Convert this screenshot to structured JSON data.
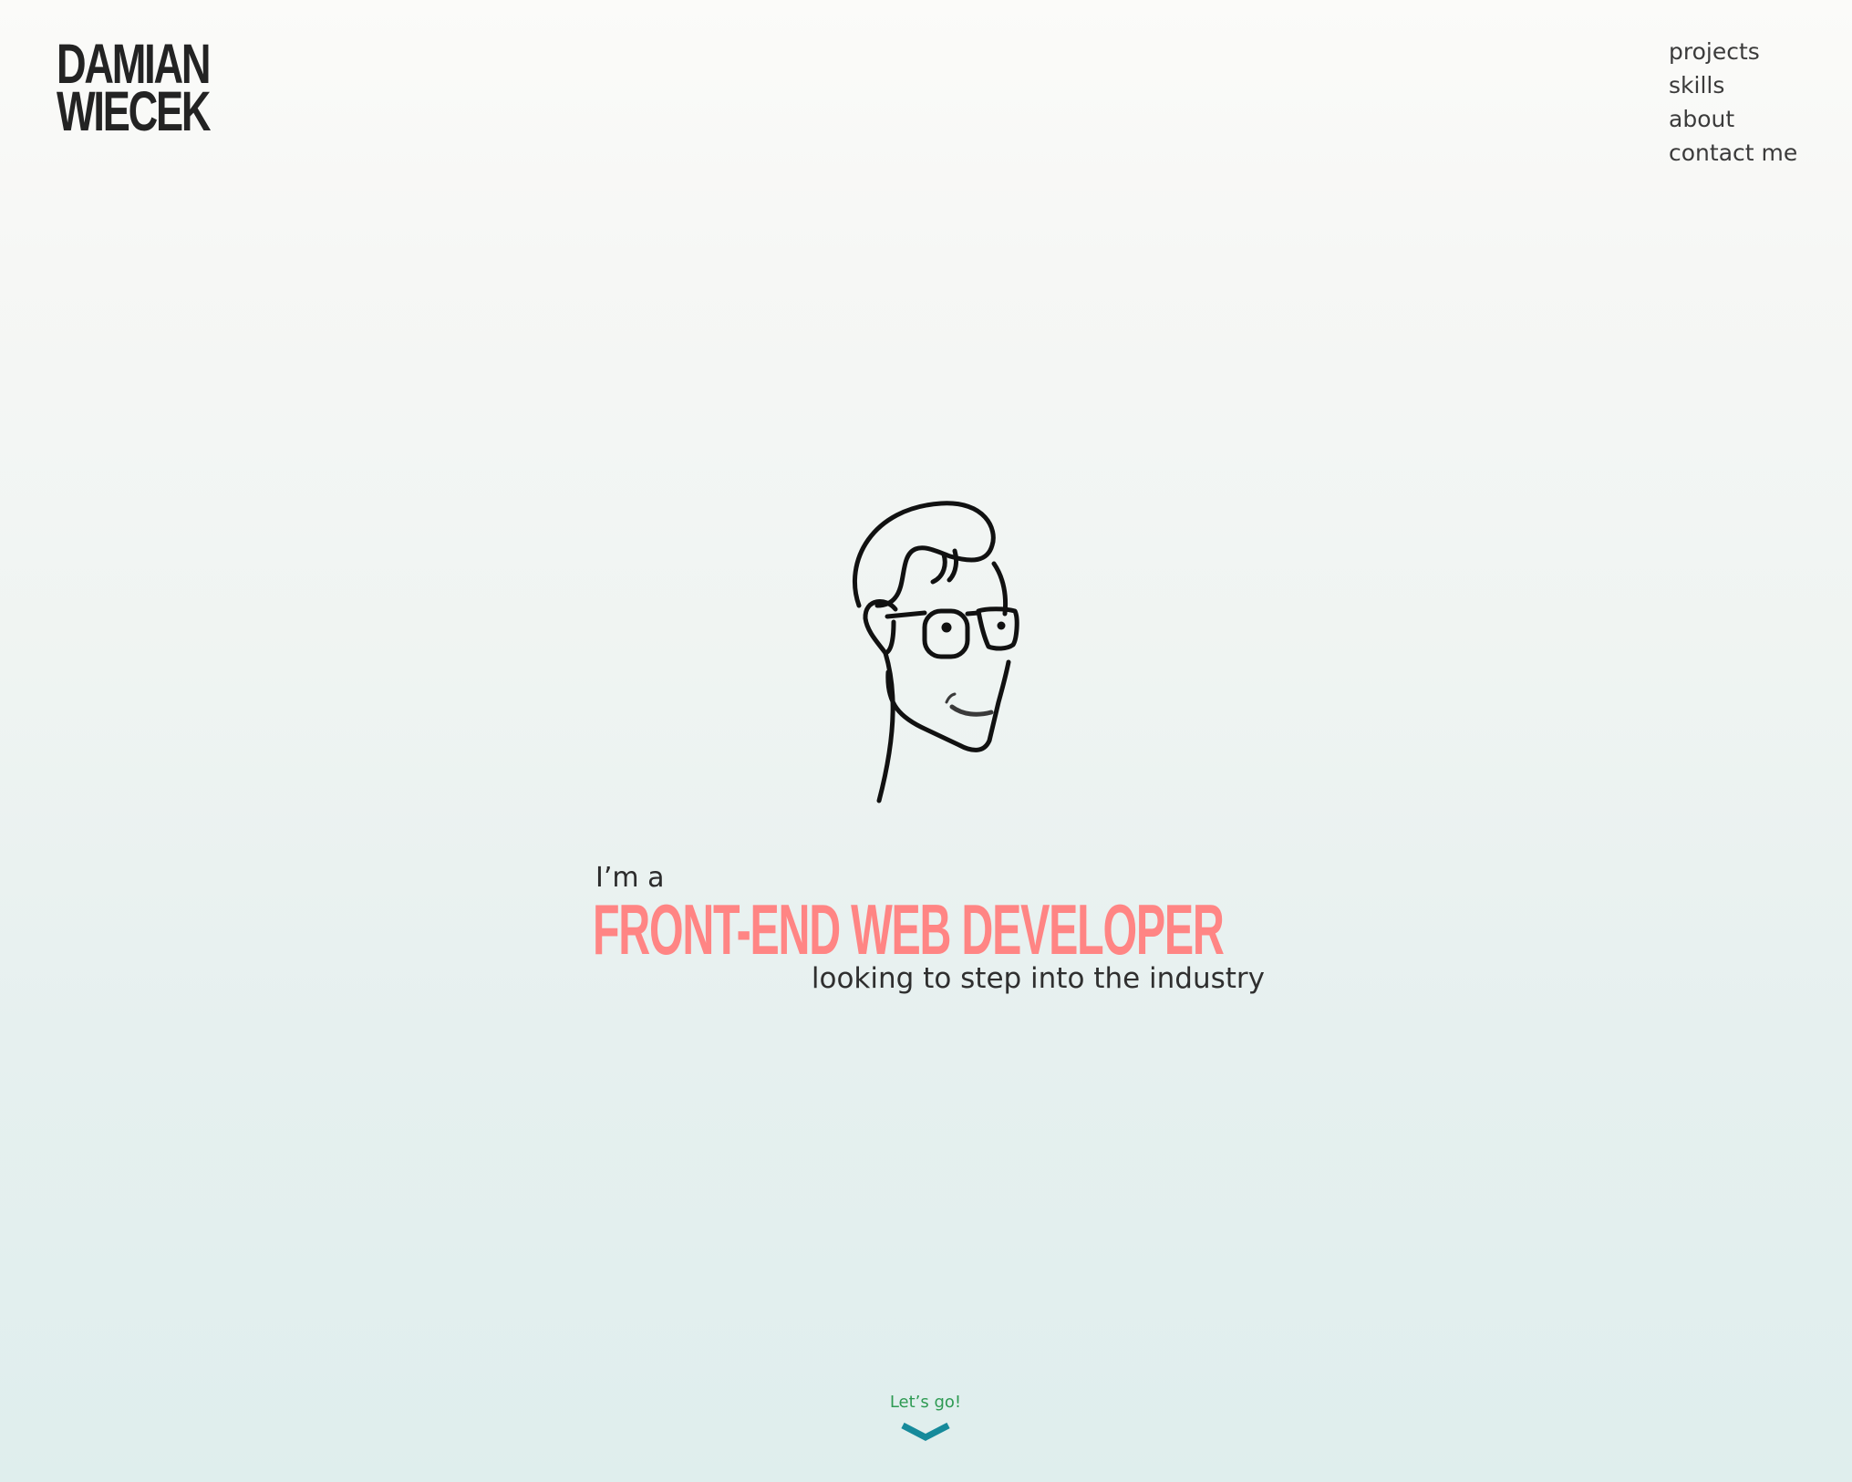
{
  "header": {
    "logo": {
      "line1": "DAMIAN",
      "line2": "WIECEK"
    },
    "nav": [
      {
        "label": "projects"
      },
      {
        "label": "skills"
      },
      {
        "label": "about"
      },
      {
        "label": "contact me"
      }
    ]
  },
  "hero": {
    "illustration_icon": "face-with-glasses-line-drawing-icon",
    "intro": "I’m a",
    "title": "FRONT-END WEB DEVELOPER",
    "subtitle": "looking to step into the industry"
  },
  "cta": {
    "label": "Let’s go!",
    "icon": "chevron-down-icon"
  },
  "colors": {
    "title_accent": "#ff8584",
    "cta_text": "#2e9a53",
    "chevron": "#168a9b",
    "text_dark": "#2f2f2f"
  }
}
